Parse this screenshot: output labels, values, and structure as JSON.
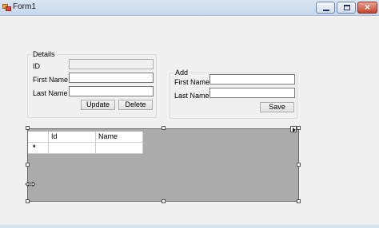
{
  "window": {
    "title": "Form1",
    "icon": "form-icon",
    "minimize": "minimize-icon",
    "maximize": "maximize-icon",
    "close": "close-icon"
  },
  "details": {
    "legend": "Details",
    "id_label": "ID",
    "id_value": "",
    "first_name_label": "First Name",
    "first_name_value": "",
    "last_name_label": "Last Name",
    "last_name_value": "",
    "update_label": "Update",
    "delete_label": "Delete"
  },
  "add": {
    "legend": "Add",
    "first_name_label": "First Name",
    "first_name_value": "",
    "last_name_label": "Last Name",
    "last_name_value": "",
    "save_label": "Save"
  },
  "grid": {
    "columns": [
      "Id",
      "Name"
    ],
    "new_row_marker": "*",
    "rows": []
  },
  "colors": {
    "grid_background": "#ababab",
    "window_background": "#f0f0f0"
  }
}
